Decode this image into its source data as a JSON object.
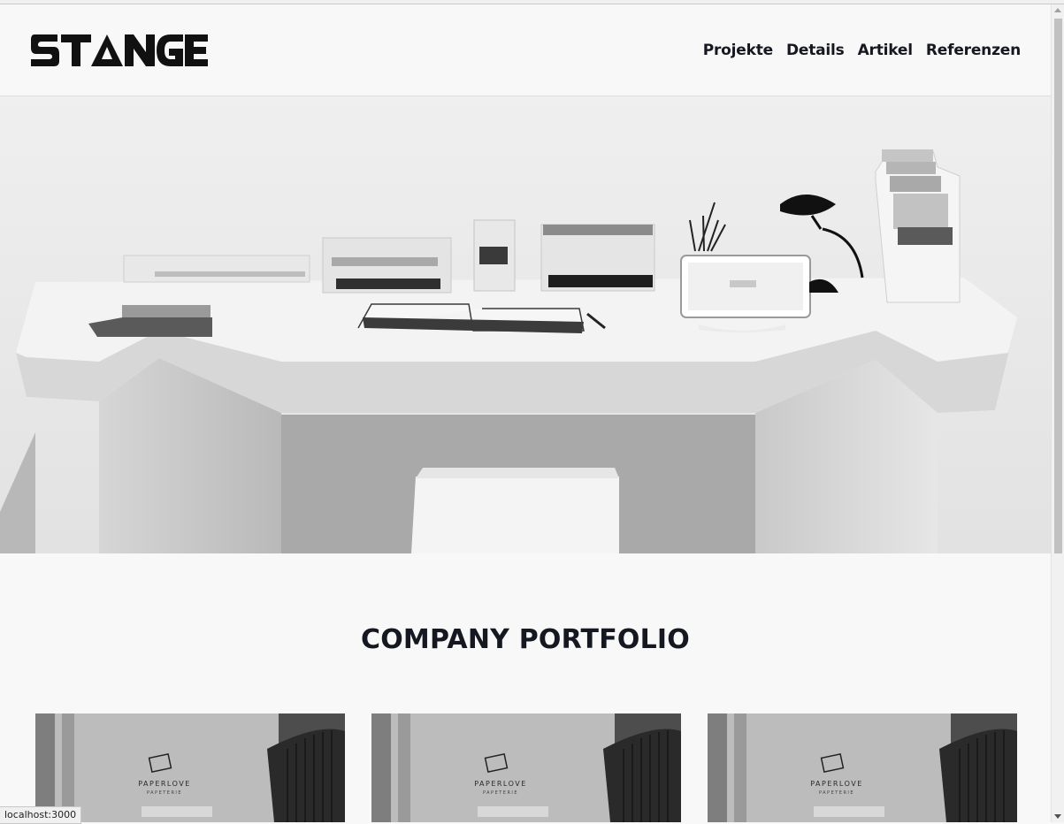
{
  "header": {
    "logo_alt": "STANGE",
    "nav": [
      {
        "label": "Projekte"
      },
      {
        "label": "Details"
      },
      {
        "label": "Artikel"
      },
      {
        "label": "Referenzen"
      }
    ]
  },
  "hero": {
    "image": "desk-photo"
  },
  "portfolio": {
    "title": "COMPANY PORTFOLIO",
    "cards": [
      {
        "brand": "PAPERLOVE",
        "sub": "PAPETERIE"
      },
      {
        "brand": "PAPERLOVE",
        "sub": "PAPETERIE"
      },
      {
        "brand": "PAPERLOVE",
        "sub": "PAPETERIE"
      }
    ]
  },
  "status_bar": {
    "url": "localhost:3000"
  }
}
